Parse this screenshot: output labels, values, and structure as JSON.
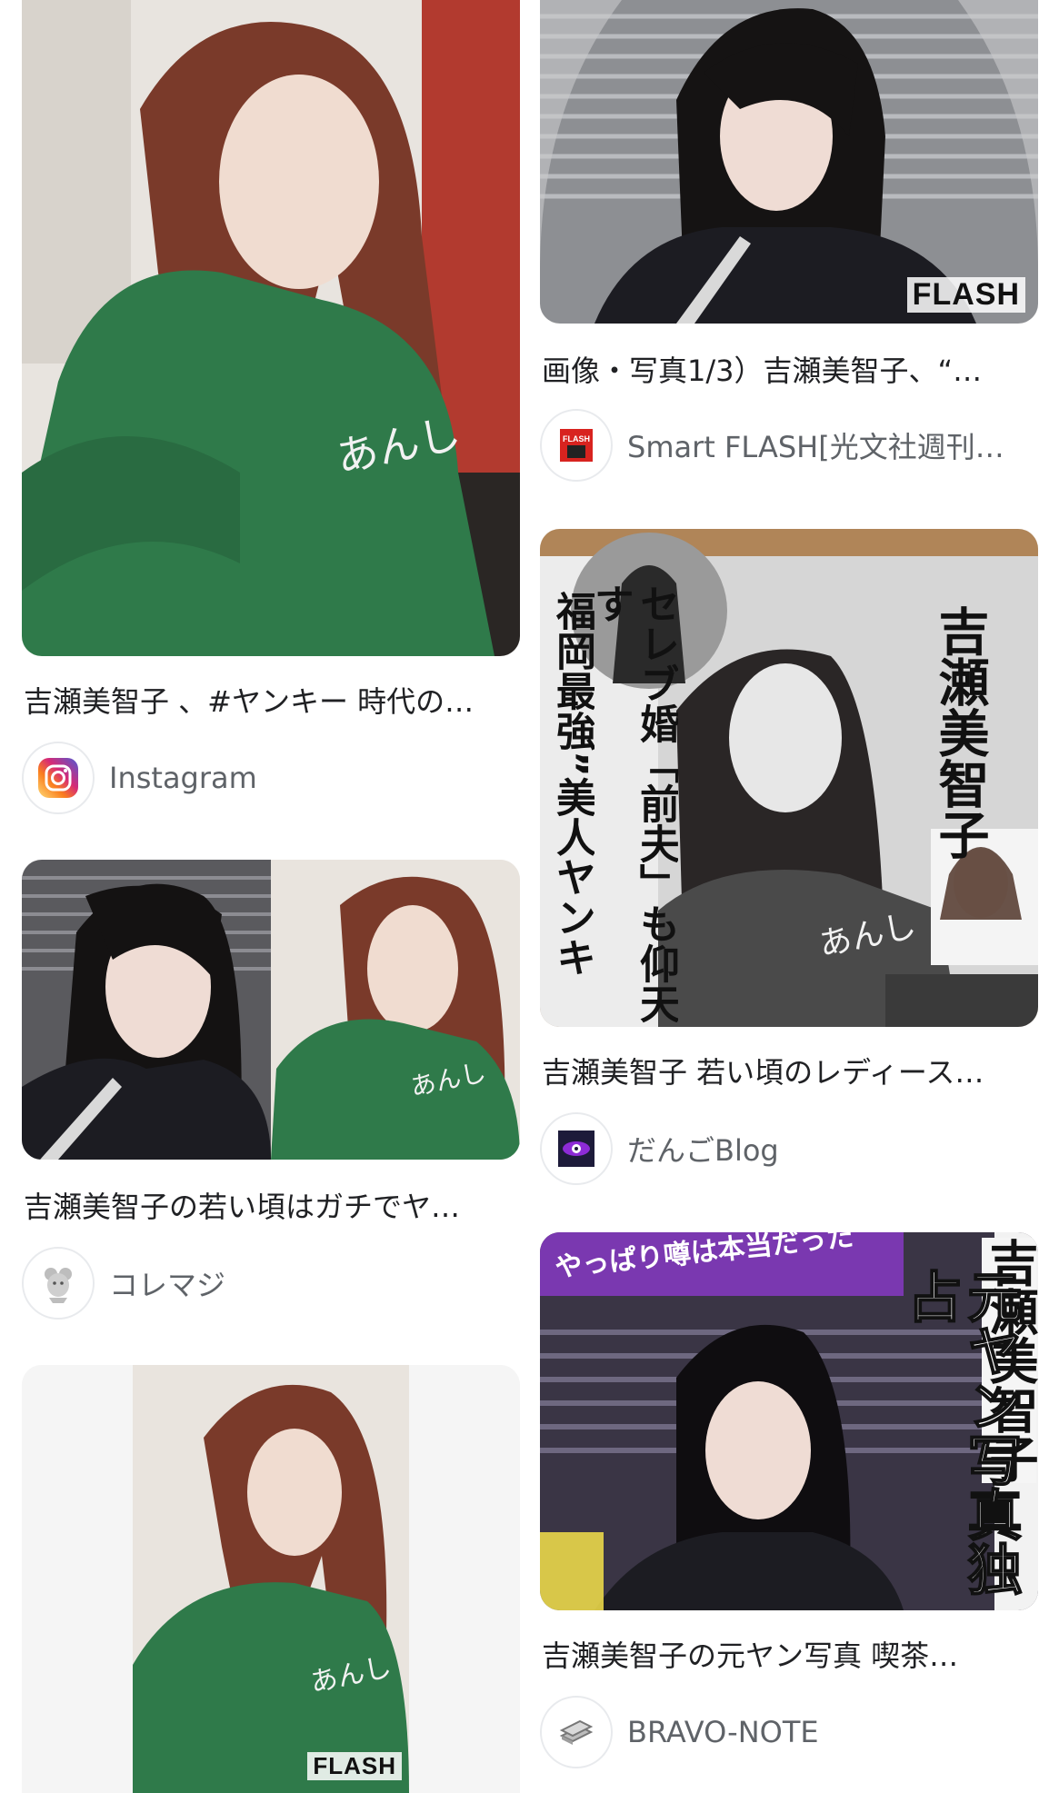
{
  "results": {
    "left": [
      {
        "title": "吉瀬美智子 、#ヤンキー 時代の…",
        "source": "Instagram",
        "favicon": "instagram-icon"
      },
      {
        "title": "吉瀬美智子の若い頃はガチでヤ…",
        "source": "コレマジ",
        "favicon": "mouse-mascot-icon"
      },
      {
        "badge": "FLASH"
      }
    ],
    "right": [
      {
        "title": "画像・写真1/3）吉瀬美智子、“…",
        "source": "Smart FLASH[光文社週刊…",
        "favicon": "flash-logo-icon",
        "badge": "FLASH"
      },
      {
        "title": "吉瀬美智子 若い頃のレディース…",
        "source": "だんごBlog",
        "favicon": "eye-icon",
        "magazine_text": {
          "name": "吉瀬美智子",
          "headline1": "セレブ婚「前夫」も仰天す",
          "headline2": "福岡最強”美人ヤンキ"
        }
      },
      {
        "title": "吉瀬美智子の元ヤン写真 喫茶…",
        "source": "BRAVO-NOTE",
        "favicon": "books-icon",
        "magazine_text": {
          "banner": "やっぱり噂は本当だった",
          "name": "吉瀬美智子",
          "headline": "元ヤン写真独占"
        }
      }
    ]
  },
  "colors": {
    "title": "#202124",
    "source": "#5f6368",
    "jacket_green": "#2f7a4a",
    "hair": "#7a3a2a"
  }
}
